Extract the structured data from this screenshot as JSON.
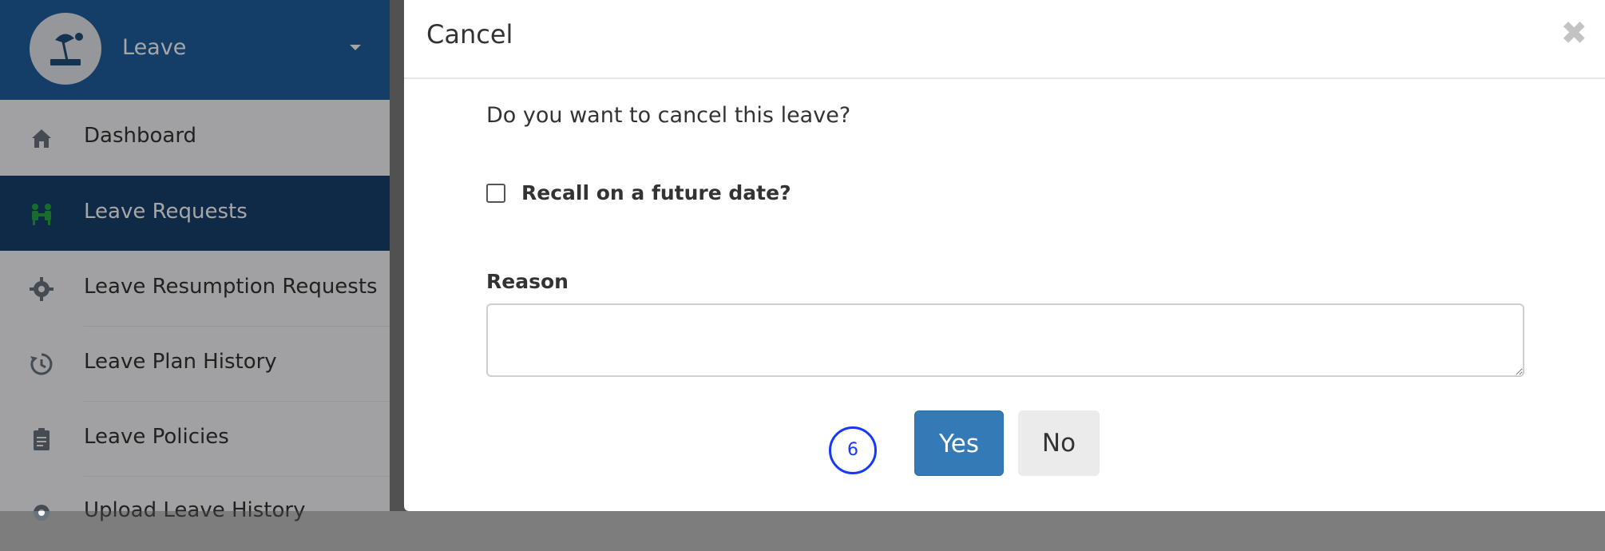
{
  "sidebar": {
    "module_title": "Leave",
    "items": [
      {
        "label": "Dashboard",
        "icon": "home-icon"
      },
      {
        "label": "Leave Requests",
        "icon": "people-icon"
      },
      {
        "label": "Leave Resumption Requests",
        "icon": "gear-icon"
      },
      {
        "label": "Leave Plan History",
        "icon": "history-icon"
      },
      {
        "label": "Leave Policies",
        "icon": "clipboard-icon"
      },
      {
        "label": "Upload Leave History",
        "icon": "gear-icon"
      }
    ],
    "active_item": "Leave Requests"
  },
  "modal": {
    "title": "Cancel",
    "question": "Do you want to cancel this leave?",
    "recall_label": "Recall on a future date?",
    "reason_label": "Reason",
    "reason_value": "",
    "yes_label": "Yes",
    "no_label": "No",
    "step_number": "6"
  },
  "colors": {
    "sidebar_header": "#1f5f9f",
    "sidebar_active": "#16416e",
    "primary_button": "#337ab7",
    "step_badge": "#1638ff"
  }
}
